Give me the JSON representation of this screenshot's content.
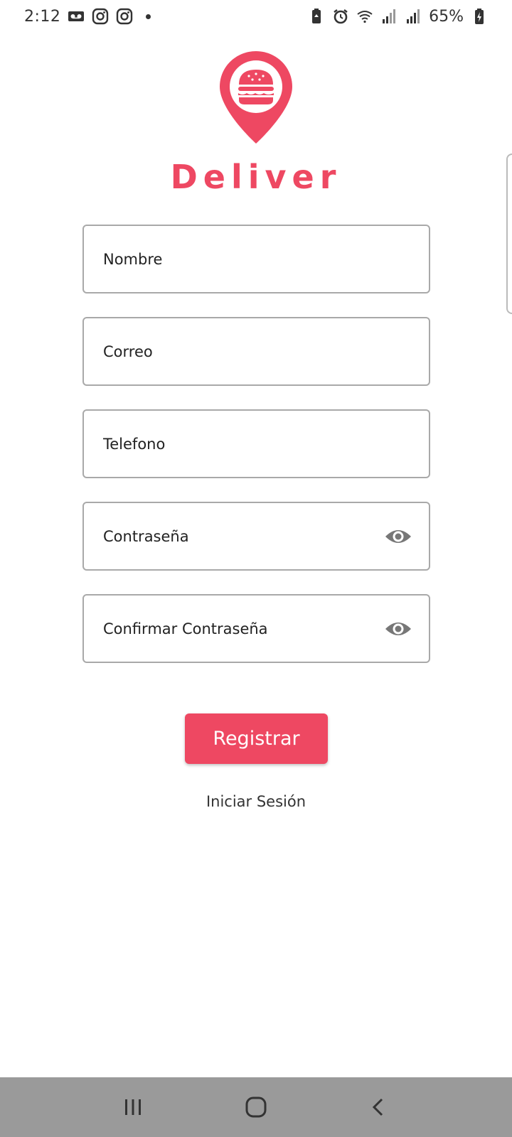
{
  "status_bar": {
    "time": "2:12",
    "battery": "65%",
    "icons": [
      "voicemail-icon",
      "instagram-icon",
      "instagram-icon",
      "notification-dot-icon",
      "battery-saver-icon",
      "alarm-icon",
      "wifi-icon",
      "signal-icon",
      "signal-icon",
      "battery-charging-icon"
    ]
  },
  "brand": {
    "title": "Deliver",
    "logo_icon": "burger-location-pin-icon",
    "accent_color": "#ee4862"
  },
  "form": {
    "nombre_placeholder": "Nombre",
    "correo_placeholder": "Correo",
    "telefono_placeholder": "Telefono",
    "password_placeholder": "Contraseña",
    "confirm_password_placeholder": "Confirmar Contraseña",
    "toggle_icon": "eye-icon"
  },
  "actions": {
    "register_label": "Registrar",
    "login_label": "Iniciar Sesión"
  },
  "nav_bar": {
    "icons": [
      "recent-apps-icon",
      "home-icon",
      "back-icon"
    ]
  }
}
